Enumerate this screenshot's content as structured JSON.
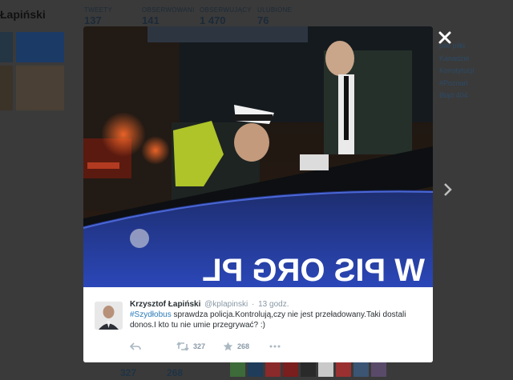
{
  "profile": {
    "name": "Łapiński",
    "stats": [
      {
        "label": "TWEETY",
        "value": "137"
      },
      {
        "label": "OBSERWOWANI",
        "value": "141"
      },
      {
        "label": "OBSERWUJĄCY",
        "value": "1 470"
      },
      {
        "label": "ULUBIONE",
        "value": "76"
      }
    ],
    "trends": [
      "pile piłki",
      "Kanadzie",
      "Konstytucji",
      "#Poznań",
      "Błąd 404"
    ],
    "bottom_counts": [
      "327",
      "268"
    ]
  },
  "modal": {
    "close_icon": "close-icon",
    "next_icon": "chevron-right-icon"
  },
  "photo": {
    "bus_text": "W PIS ORG PL"
  },
  "tweet": {
    "fullname": "Krzysztof Łapiński",
    "handle": "@kplapinski",
    "separator": "·",
    "time": "13 godz.",
    "hashtag": "#Szydłobus",
    "text": " sprawdza policja.Kontrolują,czy nie jest przeładowany.Taki dostali donos.I kto tu nie umie przegrywać? :)",
    "retweets": "327",
    "favorites": "268"
  },
  "colors": {
    "overlay": "#2e2e2e",
    "link": "#2b7bb9",
    "muted": "#8899a6",
    "text": "#292f33"
  }
}
